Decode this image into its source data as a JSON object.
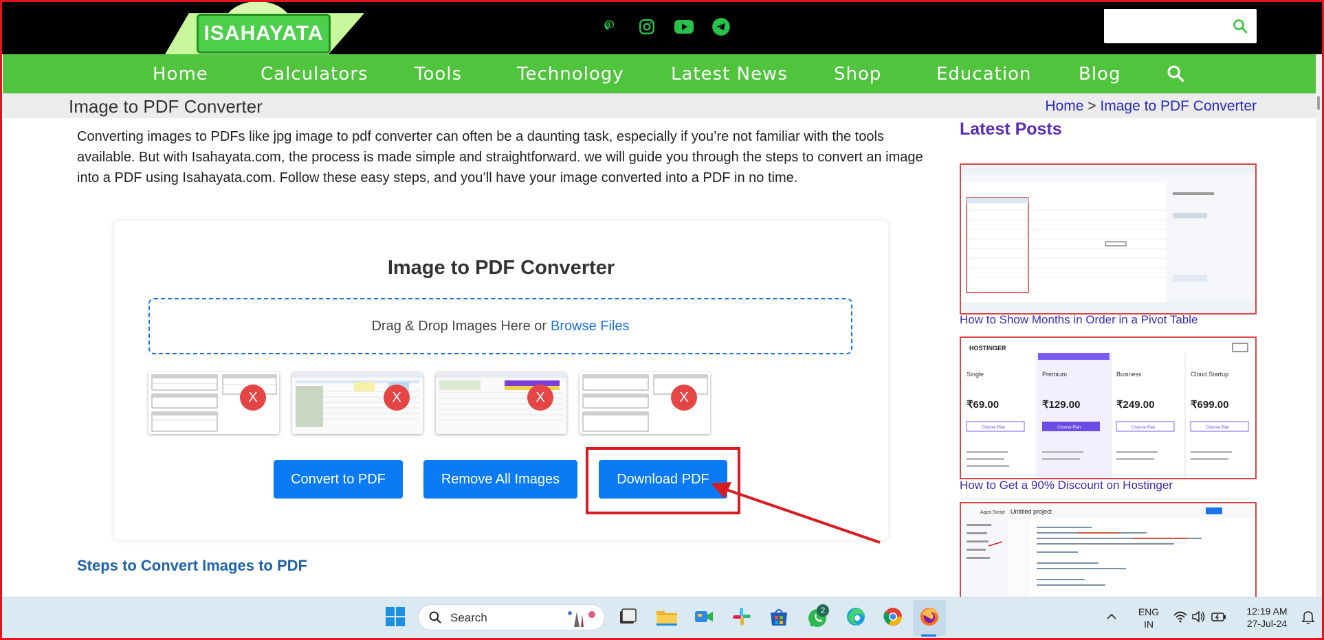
{
  "site": {
    "logo_text": "ISAHAYATA",
    "socials": [
      "pinterest-icon",
      "instagram-icon",
      "youtube-icon",
      "telegram-icon"
    ],
    "search_placeholder": ""
  },
  "nav": {
    "items": [
      "Home",
      "Calculators",
      "Tools",
      "Technology",
      "Latest News",
      "Shop",
      "Education",
      "Blog"
    ]
  },
  "breadcrumb": {
    "page_title": "Image to PDF Converter",
    "home": "Home",
    "separator": ">",
    "current": "Image to PDF Converter"
  },
  "intro": "Converting images to PDFs like jpg image to pdf converter can often be a daunting task, especially if you’re not familiar with the tools available. But with Isahayata.com, the process is made simple and straightforward. we will guide you through the steps to convert an image into a PDF using Isahayata.com. Follow these easy steps, and you’ll have your image converted into a PDF in no time.",
  "converter": {
    "title": "Image to PDF Converter",
    "drop_text": "Drag & Drop Images Here or",
    "browse": "Browse Files",
    "remove_mark": "X",
    "buttons": {
      "convert": "Convert to PDF",
      "remove_all": "Remove All Images",
      "download": "Download PDF"
    }
  },
  "steps_heading": "Steps to  Convert Images to PDF",
  "sidebar": {
    "heading": "Latest Posts",
    "posts": [
      {
        "title": "How to Show Months in Order in a Pivot Table"
      },
      {
        "title": "How to Get a 90% Discount on Hostinger"
      },
      {
        "title": ""
      }
    ],
    "hostinger": {
      "plans": [
        "Single",
        "Premium",
        "Business",
        "Cloud Startup"
      ],
      "prices": [
        "₹69.00",
        "₹129.00",
        "₹249.00",
        "₹699.00"
      ],
      "cta": "Choose Plan"
    },
    "script_title": "Untitled project"
  },
  "taskbar": {
    "search": "Search",
    "lang_line1": "ENG",
    "lang_line2": "IN",
    "time": "12:19 AM",
    "date": "27-Jul-24",
    "whatsapp_badge": "2"
  },
  "colors": {
    "nav_green": "#4fc43c",
    "button_blue": "#0a7bf5",
    "highlight_red": "#d81b22"
  }
}
